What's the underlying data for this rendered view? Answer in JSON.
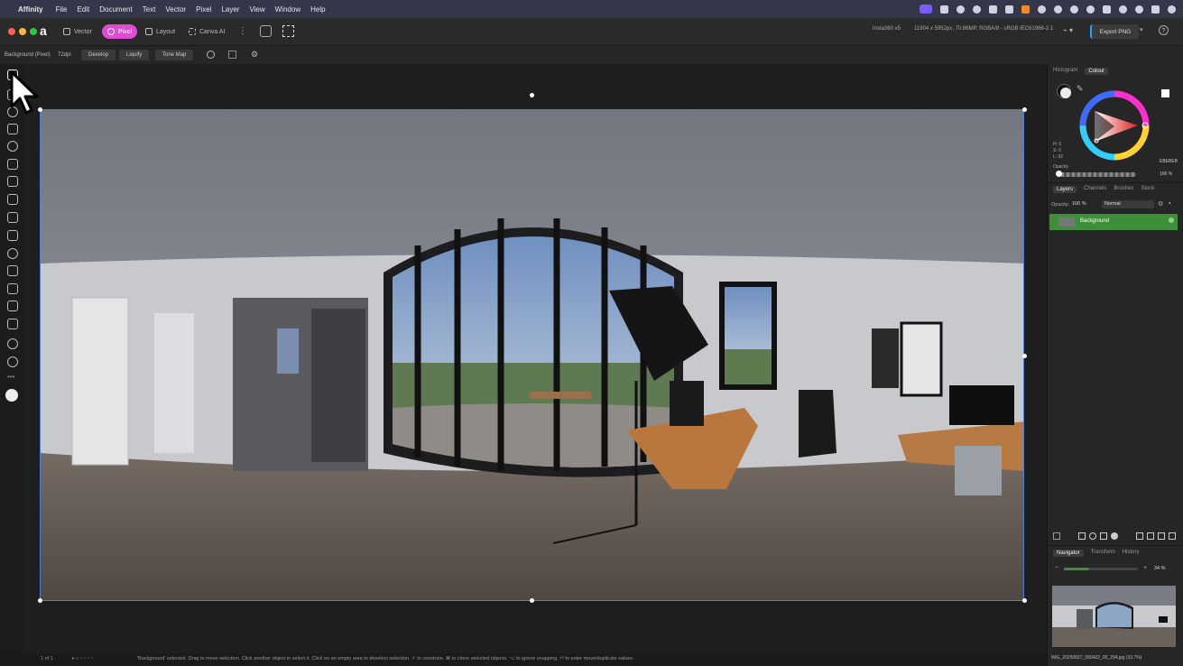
{
  "menubar": {
    "apple": "",
    "app_name": "Affinity",
    "items": [
      "File",
      "Edit",
      "Document",
      "Text",
      "Vector",
      "Pixel",
      "Layer",
      "View",
      "Window",
      "Help"
    ]
  },
  "toolbar": {
    "personas": [
      {
        "label": "Vector",
        "active": false
      },
      {
        "label": "Pixel",
        "active": true
      },
      {
        "label": "Layout",
        "active": false
      },
      {
        "label": "Canva AI",
        "active": false
      }
    ],
    "camera": "Insta360 x5",
    "doc_info": "11904 x 5952px, 70.86MP, RGBA/8 - sRGB IEC61966-2.1",
    "export_label": "Export PNG"
  },
  "contextbar": {
    "layer_name": "Background (Pixel)",
    "dpi": "72dpi",
    "buttons": [
      "Develop",
      "Liquify",
      "Tone Map"
    ]
  },
  "colour_panel": {
    "tabs": [
      {
        "label": "Histogram",
        "active": false
      },
      {
        "label": "Colour",
        "active": true
      }
    ],
    "h": "H: 0",
    "s": "S: 0",
    "l": "L: 92",
    "hex": "EBEBEB",
    "opacity_label": "Opacity",
    "opacity_value": "100 %"
  },
  "layers_panel": {
    "tabs": [
      {
        "label": "Layers",
        "active": true
      },
      {
        "label": "Channels",
        "active": false
      },
      {
        "label": "Brushes",
        "active": false
      },
      {
        "label": "Stock",
        "active": false
      }
    ],
    "opacity_label": "Opacity:",
    "opacity_value": "100 %",
    "blend_mode": "Normal",
    "layers": [
      {
        "name": "Background",
        "selected": true
      }
    ]
  },
  "navigator_panel": {
    "tabs": [
      {
        "label": "Navigator",
        "active": true
      },
      {
        "label": "Transform",
        "active": false
      },
      {
        "label": "History",
        "active": false
      }
    ],
    "zoom": "34 %",
    "zoom_fraction": 0.34,
    "filename": "IMG_20250827_090422_00_294.jpg (33.7%)"
  },
  "statusbar": {
    "page": "1 of 1",
    "hint": "'Background' selected. Drag to move selection. Click another object to select it. Click on an empty area to deselect selection. ⇧ to constrain. ⌘ to clone selected objects. ⌥ to ignore snapping. ⏎ to enter move/duplicate values."
  },
  "colors": {
    "accent": "#e04bd6",
    "layer_selected": "#3d8f3a",
    "selection_border": "#4a7ed6"
  }
}
